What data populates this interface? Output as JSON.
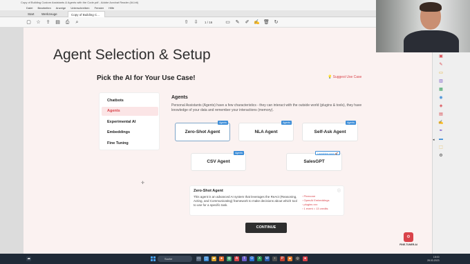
{
  "window": {
    "title": "Copy of Building Custom Assistants & Agents with the Code.pdf - Adobe Acrobat Reader (64-bit)",
    "menu": [
      "Datei",
      "Bearbeiten",
      "Anzeige",
      "Unterschreiben",
      "Fenster",
      "Hilfe"
    ]
  },
  "tabs": [
    {
      "label": "Start"
    },
    {
      "label": "Werkzeuge"
    },
    {
      "label": "Copy of Building C...",
      "close": "×"
    }
  ],
  "toolbar": {
    "page_current": "1",
    "page_total": "/ 16"
  },
  "slide": {
    "title": "Agent Selection & Setup",
    "subtitle": "Pick the AI for Your Use Case!",
    "suggest": "Suggest Use Case",
    "menu": [
      "Chatbots",
      "Agents",
      "Experimental AI",
      "Embeddings",
      "Fine Tuning"
    ],
    "active_menu_index": 1,
    "section_title": "Agents",
    "section_desc": "Personal Assistants (Agents) have a few characteristics - they can interact with the outside world (plugins & tools), they have knowledge of your data and remember your interactions (memory).",
    "cards": [
      {
        "label": "Zero-Shot Agent",
        "badge": "Agents",
        "selected": true
      },
      {
        "label": "NLA Agent",
        "badge": "Agents"
      },
      {
        "label": "Self-Ask Agent",
        "badge": "Agents"
      },
      {
        "label": "CSV Agent",
        "badge": "Agents"
      },
      {
        "label": "SalesGPT",
        "badge": "Launching soon 🚀"
      }
    ],
    "info": {
      "title": "Zero-Shot Agent",
      "desc": "This agent is an advanced AI system that leverages the ReAct (Reasoning, Acting, and Communicating) framework to make decisions about which tool to use for a specific task.",
      "tags": [
        "Pinecone",
        "OpenAI Embeddings",
        "plugins xxx",
        "1 event = 13 credits"
      ]
    },
    "cta": "CONTINUE",
    "brand": "FINE-TUNER.AI"
  },
  "taskbar": {
    "search_placeholder": "Suche",
    "time": "18:00",
    "date": "28.03.2023"
  },
  "colors": {
    "accent": "#d9434a",
    "badge": "#3e8ed8",
    "slide_bg": "#fbf2f1",
    "button_dark": "#2e2e2e"
  }
}
